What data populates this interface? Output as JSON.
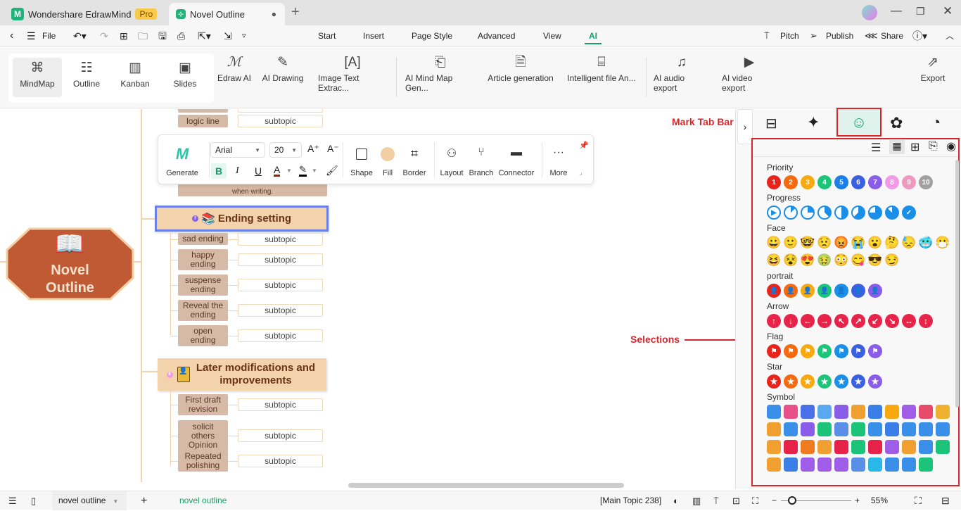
{
  "titlebar": {
    "app_name": "Wondershare EdrawMind",
    "badge": "Pro",
    "doc_tab": "Novel Outline",
    "new_tab": "+"
  },
  "menubar": {
    "file": "File",
    "tabs": [
      "Start",
      "Insert",
      "Page Style",
      "Advanced",
      "View",
      "AI"
    ],
    "active_tab": "AI",
    "right": [
      "Pitch",
      "Publish",
      "Share"
    ]
  },
  "ribbon": {
    "views": [
      "MindMap",
      "Outline",
      "Kanban",
      "Slides"
    ],
    "active_view": "MindMap",
    "ai_tools": [
      "Edraw AI",
      "AI Drawing",
      "Image Text Extrac...",
      "AI Mind Map Gen...",
      "Article generation",
      "Intelligent file An...",
      "AI audio export",
      "AI video export"
    ],
    "export": "Export"
  },
  "floatbar": {
    "generate": "Generate",
    "font": "Arial",
    "size": "20",
    "shape": "Shape",
    "fill": "Fill",
    "border": "Border",
    "layout": "Layout",
    "branch": "Branch",
    "connector": "Connector",
    "more": "More",
    "fill_color": "#f2cfa3"
  },
  "mindmap": {
    "central": [
      "Novel",
      "Outline"
    ],
    "top_subs": [
      "logic line"
    ],
    "partial_note": "when writing.",
    "ending": {
      "title": "Ending setting",
      "badge": "7",
      "subs": [
        "sad ending",
        "happy ending",
        "suspense ending",
        "Reveal the ending",
        "open ending"
      ]
    },
    "later": {
      "title": "Later modifications and improvements",
      "badge": "8",
      "subs": [
        "First draft revision",
        "solicit others Opinion",
        "Repeated polishing"
      ]
    },
    "subtopic": "subtopic"
  },
  "annotations": {
    "mark_tab_bar": "Mark Tab Bar",
    "selections": "Selections"
  },
  "panel": {
    "categories": {
      "priority": "Priority",
      "progress": "Progress",
      "face": "Face",
      "portrait": "portrait",
      "arrow": "Arrow",
      "flag": "Flag",
      "star": "Star",
      "symbol": "Symbol"
    },
    "priority": [
      {
        "n": "1",
        "c": "#e8231b"
      },
      {
        "n": "2",
        "c": "#f56a0f"
      },
      {
        "n": "3",
        "c": "#f7a90f"
      },
      {
        "n": "4",
        "c": "#1cc47a"
      },
      {
        "n": "5",
        "c": "#1a7fe8"
      },
      {
        "n": "6",
        "c": "#3a5fe0"
      },
      {
        "n": "7",
        "c": "#8a5de8"
      },
      {
        "n": "8",
        "c": "#f09ae8"
      },
      {
        "n": "9",
        "c": "#ee9ac0"
      },
      {
        "n": "10",
        "c": "#a0a0a0"
      }
    ],
    "progress_levels": [
      0,
      12.5,
      25,
      37.5,
      50,
      62.5,
      75,
      87.5,
      100
    ],
    "portrait_colors": [
      "#e8231b",
      "#f56a0f",
      "#f7a90f",
      "#1cc47a",
      "#1a8fe8",
      "#3a5fe0",
      "#8a5de8"
    ],
    "arrow_glyphs": [
      "↑",
      "↓",
      "←",
      "→",
      "↖",
      "↗",
      "↙",
      "↘",
      "↔",
      "↕"
    ],
    "flag_colors": [
      "#e8231b",
      "#f56a0f",
      "#f7a90f",
      "#1cc47a",
      "#1a8fe8",
      "#3a5fe0",
      "#8a5de8"
    ],
    "star_colors": [
      "#e8231b",
      "#f56a0f",
      "#f7a90f",
      "#1cc47a",
      "#1a8fe8",
      "#3a5fe0",
      "#8a5de8"
    ]
  },
  "statusbar": {
    "page_tab": "novel outline",
    "active_page": "novel outline",
    "selection": "[Main Topic 238]",
    "zoom": "55%",
    "zoom_minus": "−",
    "zoom_plus": "+"
  },
  "accent": "#1a9e6c"
}
